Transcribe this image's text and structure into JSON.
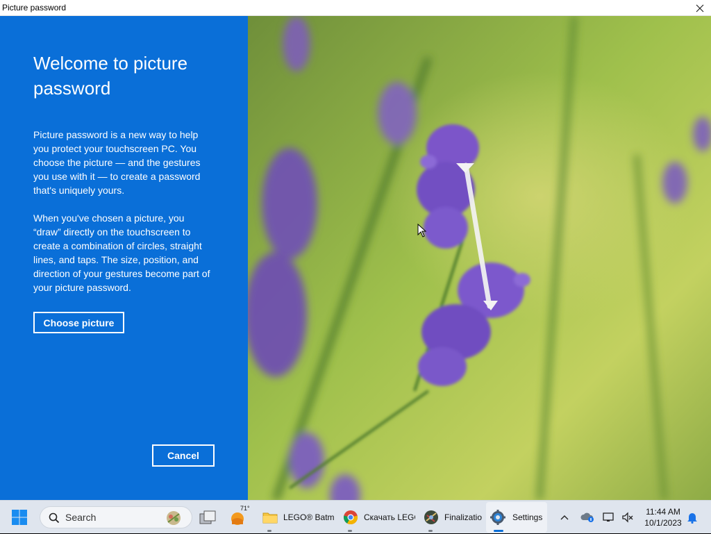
{
  "window": {
    "title": "Picture password"
  },
  "panel": {
    "heading": "Welcome to picture password",
    "paragraph1": "Picture password is a new way to help you protect your touchscreen PC. You choose the picture — and the gestures you use with it — to create a password that's uniquely yours.",
    "paragraph2": "When you've chosen a picture, you “draw” directly on the touchscreen to create a combination of circles, straight lines, and taps. The size, position, and direction of your gestures become part of your picture password.",
    "choose_label": "Choose picture",
    "cancel_label": "Cancel"
  },
  "taskbar": {
    "search_placeholder": "Search",
    "weather": "71°",
    "apps": [
      {
        "label": "LEGO® Batma",
        "icon": "folder-icon"
      },
      {
        "label": "Скачать LEGC",
        "icon": "chrome-icon"
      },
      {
        "label": "Finalizatio",
        "icon": "app-icon"
      },
      {
        "label": "Settings",
        "icon": "gear-icon"
      }
    ],
    "time": "11:44 AM",
    "date": "10/1/2023"
  },
  "colors": {
    "panel": "#0a6fd8",
    "accent": "#0a6fd8",
    "flower": "#7b55c9",
    "foliage": "#8fb84a"
  }
}
